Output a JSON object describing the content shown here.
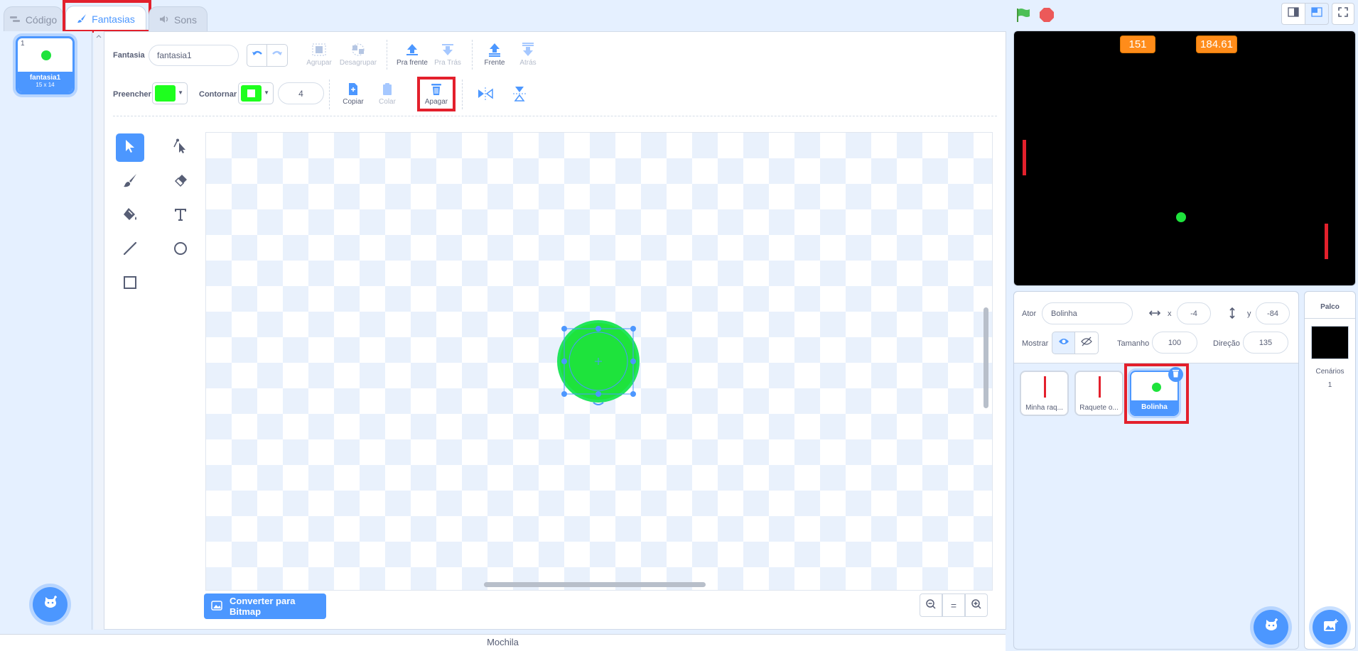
{
  "tabs": [
    {
      "label": "Código",
      "icon": "code-icon"
    },
    {
      "label": "Fantasias",
      "icon": "brush-icon"
    },
    {
      "label": "Sons",
      "icon": "speaker-icon"
    }
  ],
  "costume_list": {
    "items": [
      {
        "number": "1",
        "name": "fantasia1",
        "size": "15 x 14"
      }
    ]
  },
  "paint_editor": {
    "costume_label": "Fantasia",
    "costume_name": "fantasia1",
    "buttons": {
      "group": "Agrupar",
      "ungroup": "Desagrupar",
      "forward": "Pra frente",
      "backward": "Pra Trás",
      "front": "Frente",
      "back": "Atrás",
      "copy": "Copiar",
      "paste": "Colar",
      "delete": "Apagar"
    },
    "fill_label": "Preencher",
    "outline_label": "Contornar",
    "outline_width": "4",
    "fill_color": "#1eff1e",
    "convert_button": "Converter para Bitmap",
    "zoom_reset": "="
  },
  "stage": {
    "monitors": [
      "151",
      "184.61"
    ]
  },
  "sprite_info": {
    "sprite_label": "Ator",
    "sprite_name": "Bolinha",
    "x_label": "x",
    "x_value": "-4",
    "y_label": "y",
    "y_value": "-84",
    "show_label": "Mostrar",
    "size_label": "Tamanho",
    "size_value": "100",
    "direction_label": "Direção",
    "direction_value": "135"
  },
  "sprites": [
    {
      "name": "Minha raq..."
    },
    {
      "name": "Raquete o..."
    },
    {
      "name": "Bolinha"
    }
  ],
  "stage_pane": {
    "title": "Palco",
    "backdrops_label": "Cenários",
    "backdrops_count": "1"
  },
  "backpack": {
    "label": "Mochila"
  },
  "colors": {
    "accent": "#4c97ff",
    "highlight": "#e3202c",
    "ball": "#1ee33c",
    "monitor": "#ff8c1a"
  }
}
